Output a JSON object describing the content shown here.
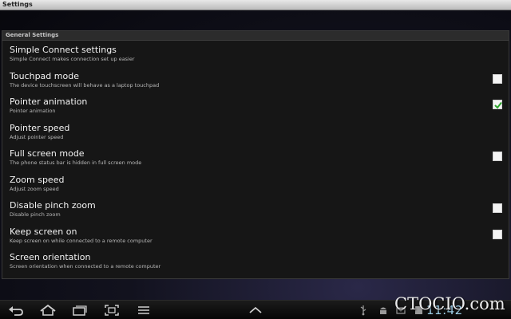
{
  "window": {
    "title": "Settings"
  },
  "section": {
    "header": "General Settings"
  },
  "rows": [
    {
      "title": "Simple Connect settings",
      "subtitle": "Simple Connect makes connection set up easier",
      "checkbox": null
    },
    {
      "title": "Touchpad mode",
      "subtitle": "The device touchscreen will behave as a laptop touchpad",
      "checkbox": false
    },
    {
      "title": "Pointer animation",
      "subtitle": "Pointer animation",
      "checkbox": true
    },
    {
      "title": "Pointer speed",
      "subtitle": "Adjust pointer speed",
      "checkbox": null
    },
    {
      "title": "Full screen mode",
      "subtitle": "The phone status bar is hidden in full screen mode",
      "checkbox": false
    },
    {
      "title": "Zoom speed",
      "subtitle": "Adjust zoom speed",
      "checkbox": null
    },
    {
      "title": "Disable pinch zoom",
      "subtitle": "Disable pinch zoom",
      "checkbox": false
    },
    {
      "title": "Keep screen on",
      "subtitle": "Keep screen on while connected to a remote computer",
      "checkbox": false
    },
    {
      "title": "Screen orientation",
      "subtitle": "Screen orientation when connected to a remote computer",
      "checkbox": null
    }
  ],
  "navbar": {
    "buttons": [
      "back-icon",
      "home-icon",
      "recent-apps-icon",
      "screenshot-icon",
      "menu-icon",
      "chevron-up-icon"
    ],
    "status_icons": [
      "usb-icon",
      "android-icon",
      "notification-icon",
      "sd-card-icon"
    ],
    "clock": "11:42"
  },
  "watermark": "CTOCIO.com",
  "colors": {
    "check_green": "#2fa52f",
    "clock_blue": "#9ecfe8",
    "panel_bg": "#161616"
  }
}
